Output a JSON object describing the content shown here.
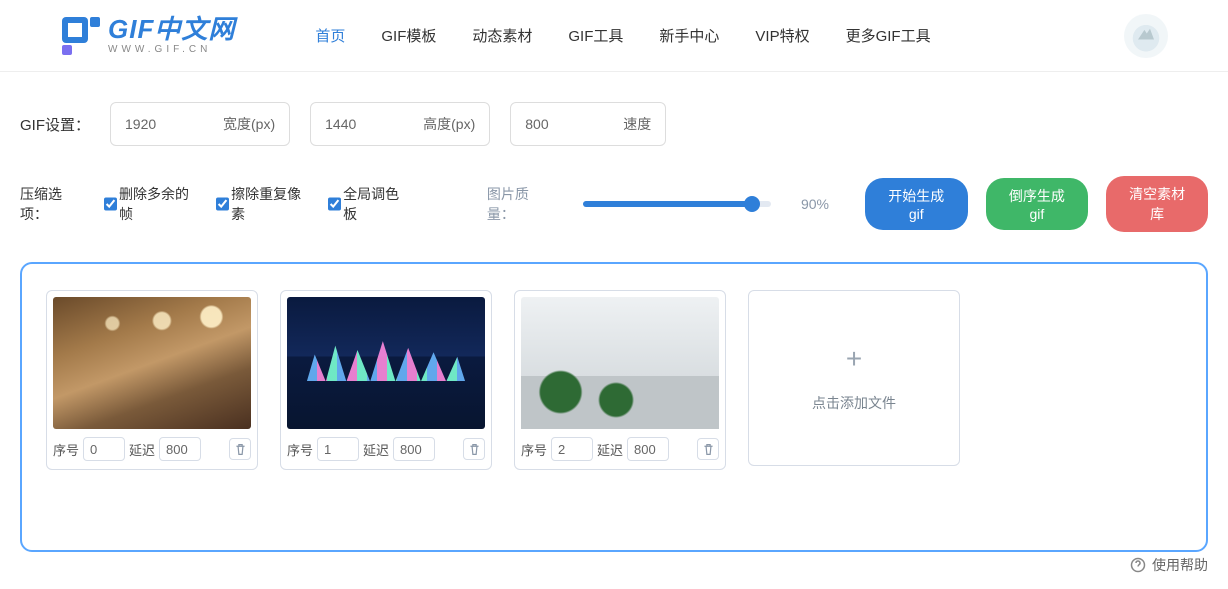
{
  "logo": {
    "title": "GIF中文网",
    "subtitle": "WWW.GIF.CN"
  },
  "nav": {
    "items": [
      {
        "label": "首页",
        "active": true
      },
      {
        "label": "GIF模板",
        "active": false
      },
      {
        "label": "动态素材",
        "active": false
      },
      {
        "label": "GIF工具",
        "active": false
      },
      {
        "label": "新手中心",
        "active": false
      },
      {
        "label": "VIP特权",
        "active": false
      },
      {
        "label": "更多GIF工具",
        "active": false
      }
    ]
  },
  "settings": {
    "prefix": "GIF设置：",
    "width": {
      "value": "1920",
      "suffix": "宽度(px)"
    },
    "height": {
      "value": "1440",
      "suffix": "高度(px)"
    },
    "speed": {
      "value": "800",
      "suffix": "速度"
    }
  },
  "compress": {
    "label": "压缩选项：",
    "opts": [
      {
        "label": "删除多余的帧",
        "checked": true
      },
      {
        "label": "擦除重复像素",
        "checked": true
      },
      {
        "label": "全局调色板",
        "checked": true
      }
    ]
  },
  "quality": {
    "label": "图片质量：",
    "percent": "90%"
  },
  "buttons": {
    "start": "开始生成gif",
    "reverse": "倒序生成gif",
    "clear": "清空素材库"
  },
  "frames": [
    {
      "seq_label": "序号",
      "seq": "0",
      "delay_label": "延迟",
      "delay": "800"
    },
    {
      "seq_label": "序号",
      "seq": "1",
      "delay_label": "延迟",
      "delay": "800"
    },
    {
      "seq_label": "序号",
      "seq": "2",
      "delay_label": "延迟",
      "delay": "800"
    }
  ],
  "add_card": {
    "label": "点击添加文件"
  },
  "help": {
    "label": "使用帮助"
  }
}
